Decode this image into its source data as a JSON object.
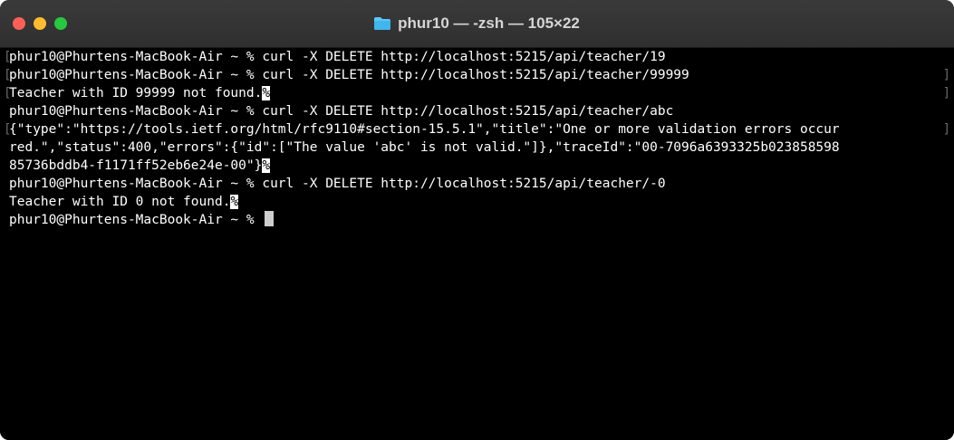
{
  "window": {
    "title": "phur10 — -zsh — 105×22",
    "colors": {
      "close": "#ff5f57",
      "minimize": "#febc2e",
      "maximize": "#28c840",
      "folder": "#5ac8fa"
    },
    "folder_icon": "folder-icon"
  },
  "terminal": {
    "lines": [
      {
        "text": "phur10@Phurtens-MacBook-Air ~ % curl -X DELETE http://localhost:5215/api/teacher/19",
        "percent": ""
      },
      {
        "text": "phur10@Phurtens-MacBook-Air ~ % curl -X DELETE http://localhost:5215/api/teacher/99999",
        "percent": ""
      },
      {
        "text": "Teacher with ID 99999 not found.",
        "percent": "%"
      },
      {
        "text": "phur10@Phurtens-MacBook-Air ~ % curl -X DELETE http://localhost:5215/api/teacher/abc",
        "percent": ""
      },
      {
        "text": "{\"type\":\"https://tools.ietf.org/html/rfc9110#section-15.5.1\",\"title\":\"One or more validation errors occur",
        "percent": ""
      },
      {
        "text": "red.\",\"status\":400,\"errors\":{\"id\":[\"The value 'abc' is not valid.\"]},\"traceId\":\"00-7096a6393325b023858598",
        "percent": ""
      },
      {
        "text": "85736bddb4-f1171ff52eb6e24e-00\"}",
        "percent": "%"
      },
      {
        "text": "phur10@Phurtens-MacBook-Air ~ % curl -X DELETE http://localhost:5215/api/teacher/-0",
        "percent": ""
      },
      {
        "text": "Teacher with ID 0 not found.",
        "percent": "%"
      },
      {
        "text": "phur10@Phurtens-MacBook-Air ~ % ",
        "percent": ""
      }
    ]
  }
}
